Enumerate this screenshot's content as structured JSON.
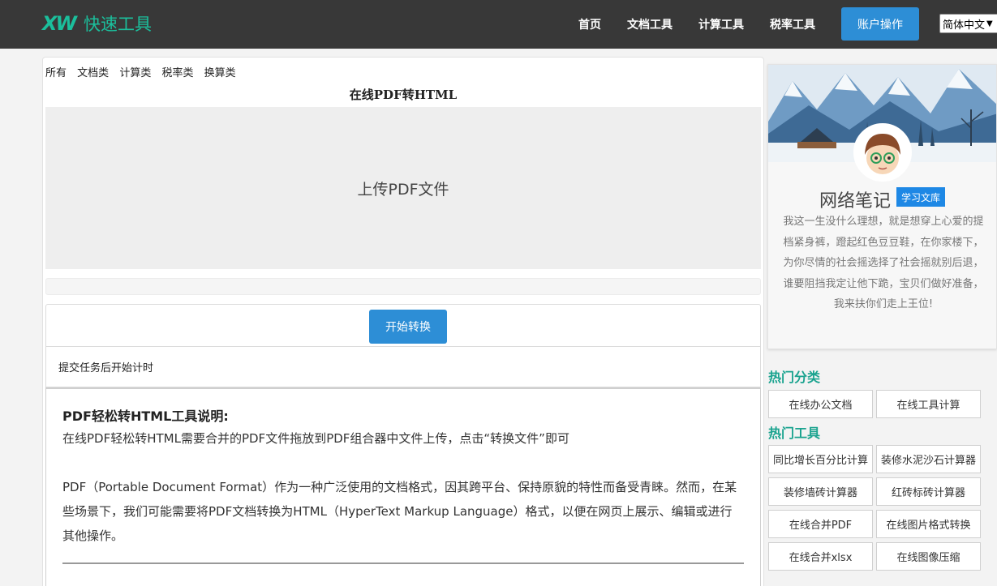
{
  "header": {
    "logo_mark": "XW",
    "logo_text": "快速工具",
    "nav": [
      "首页",
      "文档工具",
      "计算工具",
      "税率工具"
    ],
    "account_button": "账户操作",
    "language": "简体中文"
  },
  "main": {
    "categories": [
      "所有",
      "文档类",
      "计算类",
      "税率类",
      "换算类"
    ],
    "title": "在线PDF转HTML",
    "upload_label": "上传PDF文件",
    "start_button": "开始转换",
    "timer_text": "提交任务后开始计时",
    "description": {
      "title": "PDF轻松转HTML工具说明:",
      "line1": "在线PDF轻松转HTML需要合并的PDF文件拖放到PDF组合器中文件上传，点击“转换文件”即可",
      "para": "PDF（Portable Document Format）作为一种广泛使用的文档格式，因其跨平台、保持原貌的特性而备受青睐。然而，在某些场景下，我们可能需要将PDF文档转换为HTML（HyperText Markup Language）格式，以便在网页上展示、编辑或进行其他操作。"
    }
  },
  "profile": {
    "name": "网络笔记",
    "badge": "学习文库",
    "bio": "我这一生没什么理想，就是想穿上心爱的提档紧身裤，蹬起红色豆豆鞋，在你家楼下，为你尽情的社会摇选择了社会摇就别后退，谁要阻挡我定让他下跪，宝贝们做好准备，我来扶你们走上王位!"
  },
  "sidebar": {
    "hot_categories_title": "热门分类",
    "hot_categories": [
      "在线办公文档",
      "在线工具计算"
    ],
    "hot_tools_title": "热门工具",
    "hot_tools": [
      "同比增长百分比计算",
      "装修水泥沙石计算器",
      "装修墙砖计算器",
      "红砖标砖计算器",
      "在线合并PDF",
      "在线图片格式转换",
      "在线合并xlsx",
      "在线图像压缩"
    ]
  },
  "colors": {
    "header_bg": "#383838",
    "brand": "#1bbf9c",
    "accent_button": "#2d8ed6",
    "sidebar_heading": "#1aa38f",
    "badge": "#1e88e5"
  },
  "icons": [
    "logo-icon",
    "chevron-down-icon",
    "avatar-image",
    "mountain-banner-image"
  ]
}
